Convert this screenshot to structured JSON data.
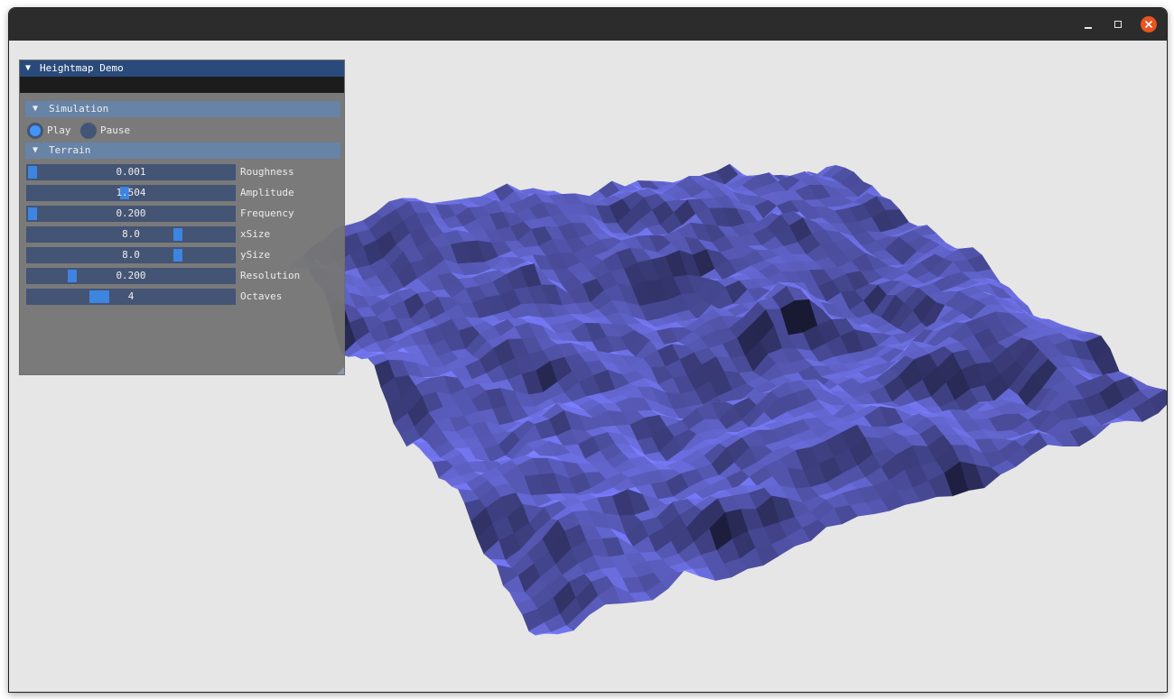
{
  "window": {
    "controls": {
      "minimize_icon": "minimize-icon",
      "maximize_icon": "maximize-icon",
      "close_icon": "close-icon"
    }
  },
  "panel": {
    "title": "Heightmap Demo",
    "collapse_arrow": "▼",
    "sections": {
      "simulation": {
        "label": "Simulation",
        "arrow": "▼"
      },
      "terrain": {
        "label": "Terrain",
        "arrow": "▼"
      }
    },
    "simulation": {
      "play_label": "Play",
      "pause_label": "Pause",
      "selected": "Play"
    },
    "sliders": [
      {
        "label": "Roughness",
        "value": "0.001",
        "fraction": 0.0
      },
      {
        "label": "Amplitude",
        "value": "1.504",
        "fraction": 0.47
      },
      {
        "label": "Frequency",
        "value": "0.200",
        "fraction": 0.0
      },
      {
        "label": "xSize",
        "value": "8.0",
        "fraction": 0.74
      },
      {
        "label": "ySize",
        "value": "8.0",
        "fraction": 0.74
      },
      {
        "label": "Resolution",
        "value": "0.200",
        "fraction": 0.2
      },
      {
        "label": "Octaves",
        "value": "4",
        "fraction": 0.33
      }
    ]
  },
  "viewport": {
    "terrain_color": "#6f72e8",
    "background_color": "#e6e6e6"
  }
}
